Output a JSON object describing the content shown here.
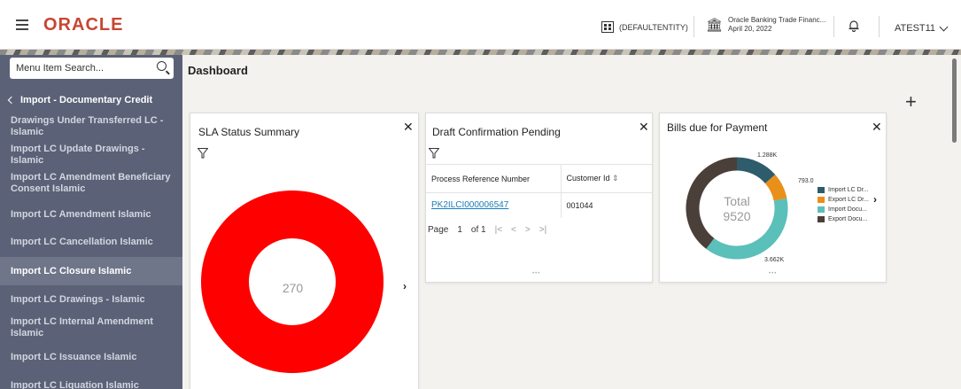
{
  "header": {
    "logo": "ORACLE",
    "entity": "(DEFAULTENTITY)",
    "bank_name": "Oracle Banking Trade Financ...",
    "date": "April 20, 2022",
    "user": "ATEST11"
  },
  "sidebar": {
    "search_placeholder": "Menu Item Search...",
    "back_label": "Import - Documentary Credit",
    "items": [
      {
        "label": "Drawings Under Transferred LC - Islamic"
      },
      {
        "label": "Import LC Update Drawings - Islamic"
      },
      {
        "label": "Import LC Amendment Beneficiary Consent Islamic"
      },
      {
        "label": "Import LC Amendment Islamic"
      },
      {
        "label": "Import LC Cancellation Islamic"
      },
      {
        "label": "Import LC Closure Islamic",
        "active": true
      },
      {
        "label": "Import LC Drawings - Islamic"
      },
      {
        "label": "Import LC Internal Amendment Islamic"
      },
      {
        "label": "Import LC Issuance Islamic"
      },
      {
        "label": "Import LC Liquation Islamic"
      }
    ]
  },
  "main": {
    "title": "Dashboard",
    "add_icon": "plus-icon"
  },
  "sla_card": {
    "title": "SLA Status Summary",
    "total": "270",
    "ring_color": "#ff0000"
  },
  "draft_card": {
    "title": "Draft Confirmation Pending",
    "columns": [
      "Process Reference Number",
      "Customer Id"
    ],
    "rows": [
      {
        "ref": "PK2ILCI000006547",
        "customer": "001044"
      }
    ],
    "pager": {
      "page_label": "Page",
      "page": "1",
      "of": "of 1"
    }
  },
  "bills_card": {
    "title": "Bills due for Payment",
    "total_label": "Total",
    "total_value": "9520",
    "value_labels": {
      "a": "1.288K",
      "b": "793.0",
      "c": "3.662K"
    }
  },
  "chart_data": {
    "type": "pie",
    "title": "Bills due for Payment",
    "categories": [
      "Import LC Dr...",
      "Export LC Dr...",
      "Import Docu...",
      "Export Docu..."
    ],
    "values": [
      1288,
      793,
      3662,
      3777
    ],
    "colors": [
      "#2e5c6b",
      "#e8901a",
      "#5bbfba",
      "#4a3f39"
    ],
    "center_label": "Total 9520",
    "legend": "right"
  }
}
